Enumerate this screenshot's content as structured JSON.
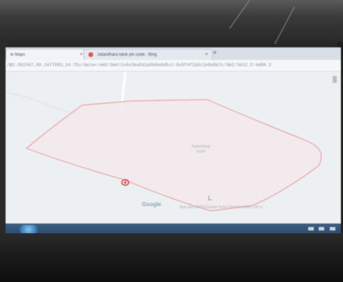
{
  "browser": {
    "tabs": [
      {
        "label": "le Maps",
        "active": true
      },
      {
        "label": "Jalandhara taluk pin code - Bing",
        "active": false
      }
    ],
    "new_tab_label": "+",
    "close_glyph": "×",
    "url": "/@2.591547,80.2477983,14.75z/data=!4m5!3m4!1s0x3ba5d1a5b0e0d5c1:0x5f4f2d3c1e9a8b7c!8m2!3d12.5!4d80.2"
  },
  "map": {
    "region_label": "Kancheep\nuram",
    "google_logo": "Google",
    "footer_links": "Map data ©2018 Google   Terms   Send feedback   200 m",
    "boundary_color": "#e8a0a0",
    "marker_color": "#d9353a"
  },
  "taskbar": {
    "tray_text": "▲ ◄ ))"
  }
}
